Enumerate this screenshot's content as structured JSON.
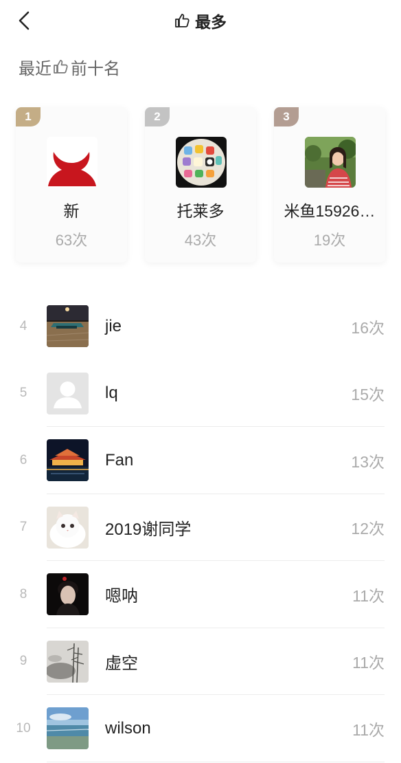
{
  "header": {
    "title": "最多",
    "back_icon": "chevron-left-icon",
    "title_icon": "thumbs-up-icon"
  },
  "section": {
    "title_prefix": "最近",
    "title_suffix": "前十名",
    "icon": "thumbs-up-icon"
  },
  "top3": [
    {
      "rank": "1",
      "name": "新",
      "count": "63次",
      "badge_color": "#c4ad86"
    },
    {
      "rank": "2",
      "name": "托莱多",
      "count": "43次",
      "badge_color": "#c3c3c3"
    },
    {
      "rank": "3",
      "name": "米鱼15926…",
      "count": "19次",
      "badge_color": "#b39d92"
    }
  ],
  "list": [
    {
      "rank": "4",
      "name": "jie",
      "count": "16次"
    },
    {
      "rank": "5",
      "name": "lq",
      "count": "15次"
    },
    {
      "rank": "6",
      "name": "Fan",
      "count": "13次"
    },
    {
      "rank": "7",
      "name": "2019谢同学",
      "count": "12次"
    },
    {
      "rank": "8",
      "name": "嗯呐",
      "count": "11次"
    },
    {
      "rank": "9",
      "name": "虚空",
      "count": "11次"
    },
    {
      "rank": "10",
      "name": "wilson",
      "count": "11次"
    }
  ]
}
